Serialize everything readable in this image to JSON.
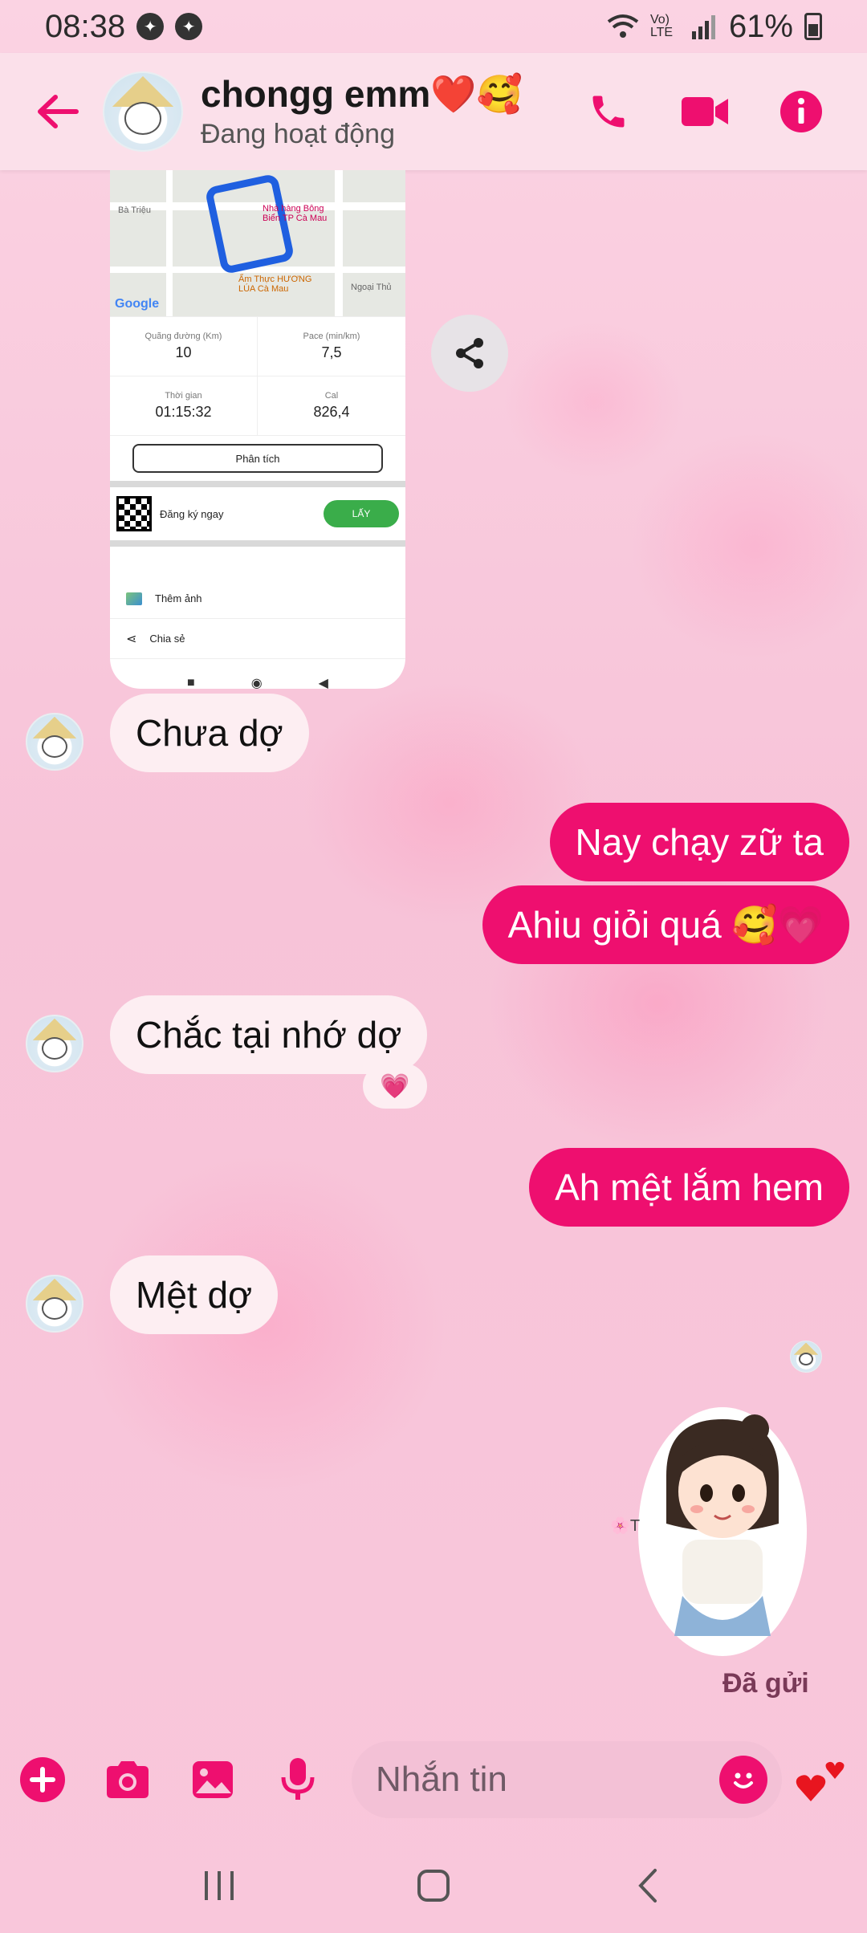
{
  "status_bar": {
    "time": "08:38",
    "battery": "61%",
    "network": "Vo) LTE"
  },
  "header": {
    "contact_name": "chongg emm❤️🥰",
    "contact_status": "Đang hoạt động"
  },
  "shared_card": {
    "map_labels": [
      "Bà Triệu",
      "Nhà hàng Bông Biển TP Cà Mau",
      "Ẩm Thực HƯƠNG LÚA Cà Mau",
      "Ngoại Thủ"
    ],
    "google": "Google",
    "stats": [
      {
        "label": "Quãng đường (Km)",
        "value": "10"
      },
      {
        "label": "Pace (min/km)",
        "value": "7,5"
      },
      {
        "label": "Thời gian",
        "value": "01:15:32"
      },
      {
        "label": "Cal",
        "value": "826,4"
      }
    ],
    "analyze": "Phân tích",
    "promo_text": "Đăng ký ngay",
    "promo_button": "LẤY",
    "menu": [
      "Thêm ảnh",
      "Chia sẻ"
    ]
  },
  "messages": [
    {
      "direction": "in",
      "text": "Chưa dợ"
    },
    {
      "direction": "out",
      "text": "Nay chạy zữ ta"
    },
    {
      "direction": "out",
      "text": "Ahiu giỏi quá 🥰💗"
    },
    {
      "direction": "in",
      "text": "Chắc tại nhớ dợ",
      "reaction": "💗"
    },
    {
      "direction": "out",
      "text": "Ah mệt lắm hem"
    },
    {
      "direction": "in",
      "text": "Mệt dợ"
    }
  ],
  "sent_status": "Đã gửi",
  "composer": {
    "placeholder": "Nhắn tin"
  },
  "colors": {
    "accent": "#ee0f6f",
    "header_bg": "#fbe0ea",
    "incoming_bubble": "#fdeef2"
  }
}
